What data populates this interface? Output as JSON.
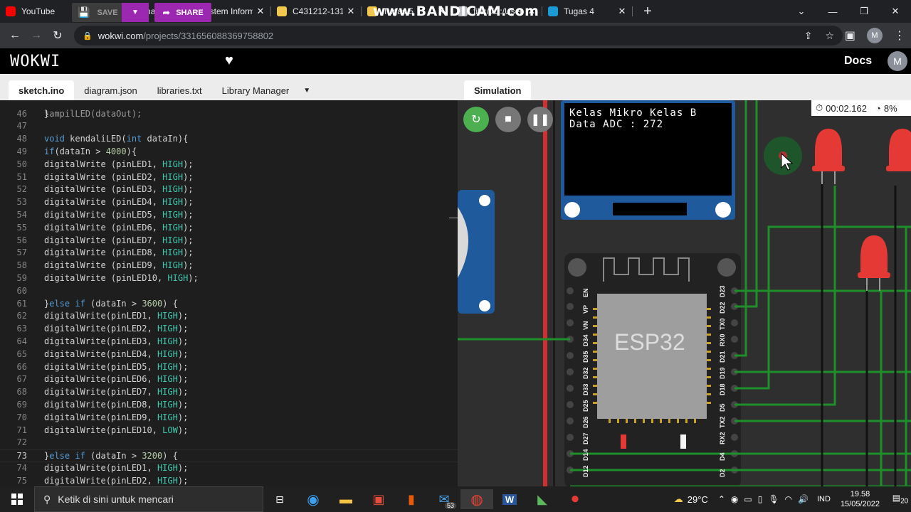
{
  "browser": {
    "tabs": [
      {
        "label": "YouTube",
        "icon": "youtube-icon",
        "color": "#ff0000"
      },
      {
        "label": "Dasbor chann",
        "icon": "youtube-icon",
        "color": "#ff0000"
      },
      {
        "label": "Sistem Inform",
        "icon": "site-icon",
        "color": "#f2c94c"
      },
      {
        "label": "C431212-131",
        "icon": "site-icon",
        "color": "#f2c94c"
      },
      {
        "label": "Tugas 5",
        "icon": "site-icon",
        "color": "#f2c94c"
      },
      {
        "label": "file:///C:/User",
        "icon": "globe-icon",
        "color": "#bdc1c6"
      },
      {
        "label": "Tugas 4",
        "icon": "classroom-icon",
        "color": "#1a9bd7"
      }
    ],
    "watermark": "www.BANDICAM.com",
    "url_host": "wokwi.com",
    "url_path": "/projects/331656088369758802",
    "profile_initial": "M"
  },
  "wokwi": {
    "logo": "WOKWI",
    "save_label": "SAVE",
    "share_label": "SHARE",
    "docs_label": "Docs",
    "avatar_initial": "M"
  },
  "editor": {
    "tabs": [
      "sketch.ino",
      "diagram.json",
      "libraries.txt",
      "Library Manager"
    ],
    "active_tab": "sketch.ino"
  },
  "code": [
    {
      "n": "46",
      "t": "}"
    },
    {
      "n": "47",
      "t": ""
    },
    {
      "n": "48",
      "t": "void kendaliLED(int dataIn){"
    },
    {
      "n": "49",
      "t": "if(dataIn > 4000){"
    },
    {
      "n": "50",
      "t": "digitalWrite (pinLED1, HIGH);"
    },
    {
      "n": "51",
      "t": "digitalWrite (pinLED2, HIGH);"
    },
    {
      "n": "52",
      "t": "digitalWrite (pinLED3, HIGH);"
    },
    {
      "n": "53",
      "t": "digitalWrite (pinLED4, HIGH);"
    },
    {
      "n": "54",
      "t": "digitalWrite (pinLED5, HIGH);"
    },
    {
      "n": "55",
      "t": "digitalWrite (pinLED6, HIGH);"
    },
    {
      "n": "56",
      "t": "digitalWrite (pinLED7, HIGH);"
    },
    {
      "n": "57",
      "t": "digitalWrite (pinLED8, HIGH);"
    },
    {
      "n": "58",
      "t": "digitalWrite (pinLED9, HIGH);"
    },
    {
      "n": "59",
      "t": "digitalWrite (pinLED10, HIGH);"
    },
    {
      "n": "60",
      "t": ""
    },
    {
      "n": "61",
      "t": "}else if (dataIn > 3600) {"
    },
    {
      "n": "62",
      "t": "digitalWrite(pinLED1, HIGH);"
    },
    {
      "n": "63",
      "t": "digitalWrite(pinLED2, HIGH);"
    },
    {
      "n": "64",
      "t": "digitalWrite(pinLED3, HIGH);"
    },
    {
      "n": "65",
      "t": "digitalWrite(pinLED4, HIGH);"
    },
    {
      "n": "66",
      "t": "digitalWrite(pinLED5, HIGH);"
    },
    {
      "n": "67",
      "t": "digitalWrite(pinLED6, HIGH);"
    },
    {
      "n": "68",
      "t": "digitalWrite(pinLED7, HIGH);"
    },
    {
      "n": "69",
      "t": "digitalWrite(pinLED8, HIGH);"
    },
    {
      "n": "70",
      "t": "digitalWrite(pinLED9, HIGH);"
    },
    {
      "n": "71",
      "t": "digitalWrite(pinLED10, LOW);"
    },
    {
      "n": "72",
      "t": ""
    },
    {
      "n": "73",
      "t": "}else if (dataIn > 3200) {",
      "current": true
    },
    {
      "n": "74",
      "t": "digitalWrite(pinLED1, HIGH);"
    },
    {
      "n": "75",
      "t": "digitalWrite(pinLED2, HIGH);"
    }
  ],
  "simulation": {
    "tab_label": "Simulation",
    "timer": "00:02.162",
    "cpu": "8%",
    "oled_line1": "Kelas Mikro Kelas B",
    "oled_line2": "Data ADC : 272",
    "chip_label": "ESP32",
    "pins_left": [
      "EN",
      "VP",
      "VN",
      "D34",
      "D35",
      "D32",
      "D33",
      "D25",
      "D26",
      "D27",
      "D14",
      "D12"
    ],
    "pins_right": [
      "D23",
      "D22",
      "TX0",
      "RX0",
      "D21",
      "D19",
      "D18",
      "D5",
      "TX2",
      "RX2",
      "D4",
      "D2"
    ]
  },
  "taskbar": {
    "search_placeholder": "Ketik di sini untuk mencari",
    "mail_badge": "53",
    "temperature": "29°C",
    "language": "IND",
    "time": "19.58",
    "date": "15/05/2022",
    "notifications": "20"
  },
  "colors": {
    "accent": "#9c27b0",
    "wire_green": "#1e8f2a",
    "led_red": "#e53935",
    "play_green": "#4caf50"
  }
}
